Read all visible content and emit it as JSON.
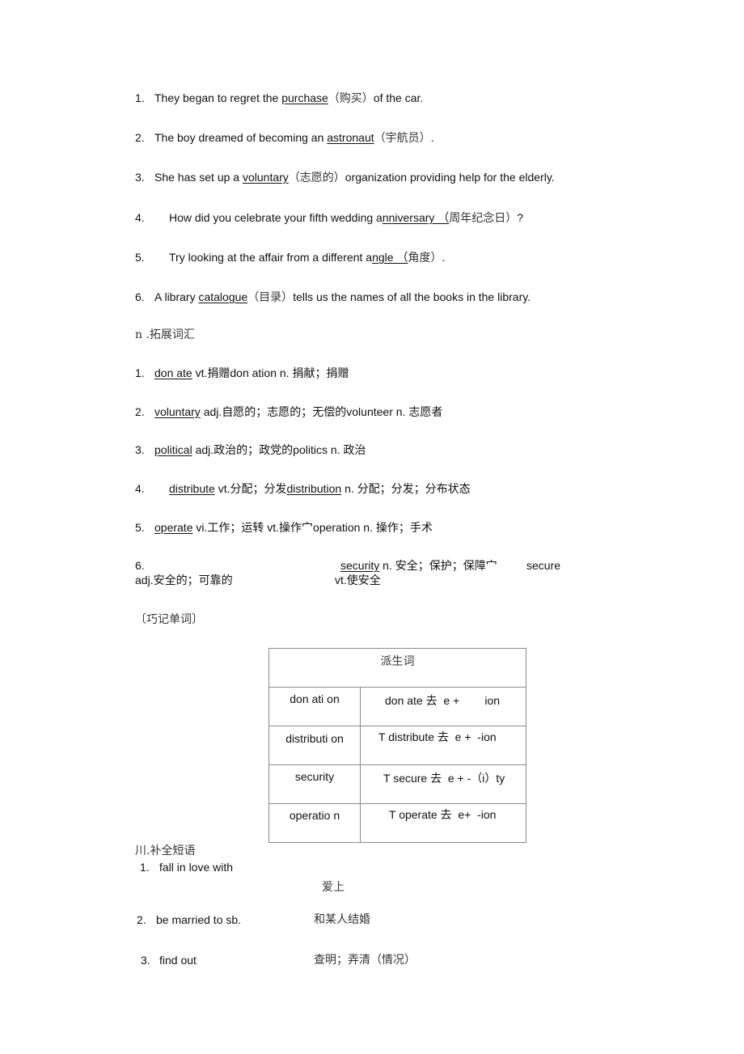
{
  "sentences": [
    {
      "num": "1.",
      "pre": "They began to regret the ",
      "word": "purchase",
      "gloss": "（购买）",
      "post": "of the car."
    },
    {
      "num": "2.",
      "pre": "The boy dreamed of becoming an ",
      "word": "astronaut",
      "gloss": "（宇航员）",
      "post": "."
    },
    {
      "num": "3.",
      "pre": "She has set up a ",
      "word": "voluntary",
      "gloss": "（志愿的）",
      "post": "organization providing help for the elderly."
    },
    {
      "num": "4.",
      "pre": "How did you celebrate your fifth wedding a",
      "word": "nniversary （",
      "gloss": "周年纪念日）",
      "post": "?"
    },
    {
      "num": "5.",
      "pre": "Try looking at the affair from a different a",
      "word": "ngle （",
      "gloss": "角度）",
      "post": "."
    },
    {
      "num": "6.",
      "pre": "A library ",
      "word": "catalogue",
      "gloss": "（目录）",
      "post": "tells us the names of all the books in the library."
    }
  ],
  "section2_title": "n .拓展词汇",
  "vocab": [
    {
      "num": "1.",
      "word": "don ate",
      "rest": " vt.捐赠don ation n. 捐献；捐赠"
    },
    {
      "num": "2.",
      "word": "voluntary",
      "rest": " adj.自愿的；志愿的；无偿的volunteer n. 志愿者"
    },
    {
      "num": "3.",
      "word": "political",
      "rest": " adj.政治的；政党的politics n. 政治"
    },
    {
      "num": "4.",
      "word": "distribute",
      "mid": " vt.分配；分发",
      "word2": "distribution",
      "rest": " n. 分配；分发；分布状态"
    },
    {
      "num": "5.",
      "word": "operate",
      "rest": " vi.工作；运转  vt.操作宀operation n. 操作；手术"
    }
  ],
  "vocab6": {
    "num": "6.",
    "word": "security",
    "rest": " n. 安全；保护；保障宀",
    "word2": "secure",
    "line2a": "adj.安全的；可靠的",
    "line2b": "vt.使安全"
  },
  "memory_title": "〔巧记单词〕",
  "table": {
    "header": "派生词",
    "rows": [
      {
        "word": "don ati on",
        "rule": "don ate 去  e +        ion"
      },
      {
        "word": "distributi on",
        "rule": "T distribute 去  e +  -ion"
      },
      {
        "word": "security",
        "rule": "T secure 去  e + -（i）ty"
      },
      {
        "word": "operatio n",
        "rule": "T operate 去  e+  -ion"
      }
    ]
  },
  "section3_title": "川.补全短语",
  "phrases": [
    {
      "num": "1.",
      "en": "fall in love with",
      "cn": "爱上"
    },
    {
      "num": "2.",
      "en": "be married to sb.",
      "cn": "和某人结婚"
    },
    {
      "num": "3.",
      "en": "find out",
      "cn": "查明；弄清（情况）"
    }
  ]
}
